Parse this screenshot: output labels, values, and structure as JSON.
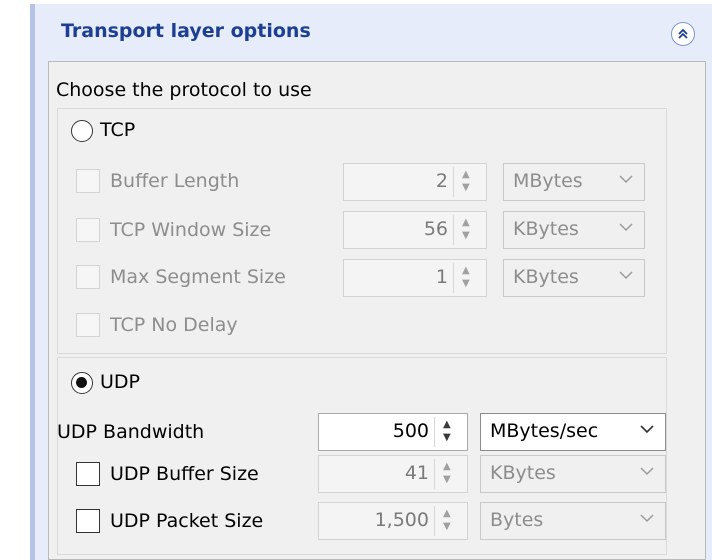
{
  "header": {
    "title": "Transport layer options",
    "collapse_icon": "double-chevron-up-icon"
  },
  "choose_label": "Choose the protocol to use",
  "tcp": {
    "radio_label": "TCP",
    "selected": false,
    "buffer_length": {
      "label": "Buffer Length",
      "checked": false,
      "value": "2",
      "unit": "MBytes"
    },
    "window_size": {
      "label": "TCP Window Size",
      "checked": false,
      "value": "56",
      "unit": "KBytes"
    },
    "max_segment": {
      "label": "Max Segment Size",
      "checked": false,
      "value": "1",
      "unit": "KBytes"
    },
    "no_delay": {
      "label": "TCP No Delay",
      "checked": false
    }
  },
  "udp": {
    "radio_label": "UDP",
    "selected": true,
    "bandwidth": {
      "label": "UDP Bandwidth",
      "value": "500",
      "unit": "MBytes/sec"
    },
    "buffer_size": {
      "label": "UDP Buffer Size",
      "checked": false,
      "value": "41",
      "unit": "KBytes"
    },
    "packet_size": {
      "label": "UDP Packet Size",
      "checked": false,
      "value": "1,500",
      "unit": "Bytes"
    }
  },
  "colors": {
    "header_text": "#1c3f94",
    "panel_bg": "#e6ecf9",
    "accent_bar": "#b4c3e6",
    "disabled_text": "#8d8d8d"
  }
}
